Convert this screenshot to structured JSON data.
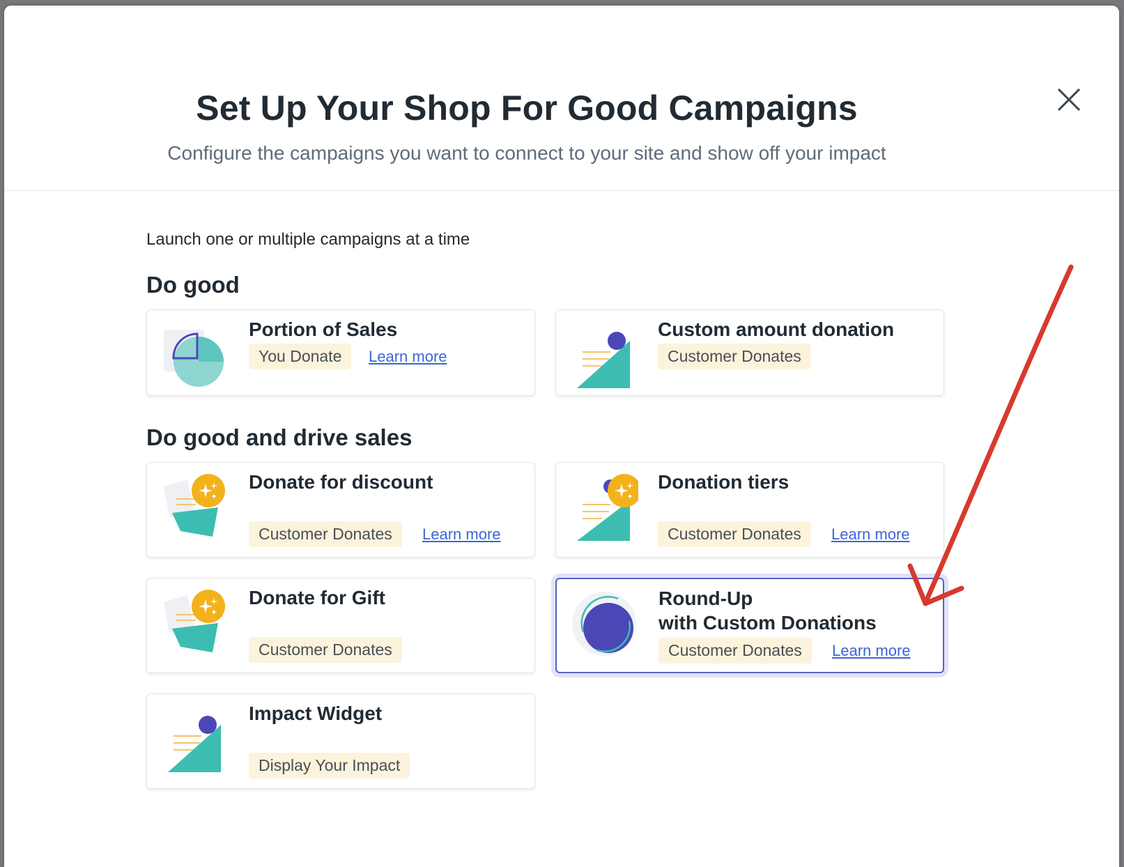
{
  "modal": {
    "title": "Set Up Your Shop For Good Campaigns",
    "subtitle": "Configure the campaigns you want to connect to your site and show off your impact",
    "close_icon": "close-icon"
  },
  "intro": "Launch one or multiple campaigns at a time",
  "sections": [
    {
      "title": "Do good",
      "cards": [
        {
          "title": "Portion of Sales",
          "badge": "You Donate",
          "link": "Learn more",
          "icon": "pie-chart-icon"
        },
        {
          "title": "Custom amount donation",
          "badge": "Customer Donates",
          "icon": "triangle-ball-icon"
        }
      ]
    },
    {
      "title": "Do good and drive sales",
      "cards": [
        {
          "title": "Donate for discount",
          "badge": "Customer Donates",
          "link": "Learn more",
          "icon": "discount-sparkle-icon"
        },
        {
          "title": "Donation tiers",
          "badge": "Customer Donates",
          "link": "Learn more",
          "icon": "tiers-sparkle-icon"
        },
        {
          "title": "Donate for Gift",
          "badge": "Customer Donates",
          "icon": "gift-sparkle-icon"
        },
        {
          "title": "Round-Up",
          "title_line2": "with Custom Donations",
          "badge": "Customer Donates",
          "link": "Learn more",
          "icon": "round-up-circle-icon",
          "selected": true
        },
        {
          "title": "Impact Widget",
          "badge": "Display Your Impact",
          "icon": "impact-widget-icon"
        }
      ]
    }
  ],
  "colors": {
    "teal": "#3dbdb1",
    "indigo": "#4b47b7",
    "amber": "#f3b21c",
    "badge_bg": "#fcf3dc",
    "link": "#3a66d6",
    "annotation_arrow": "#d63a2f"
  }
}
